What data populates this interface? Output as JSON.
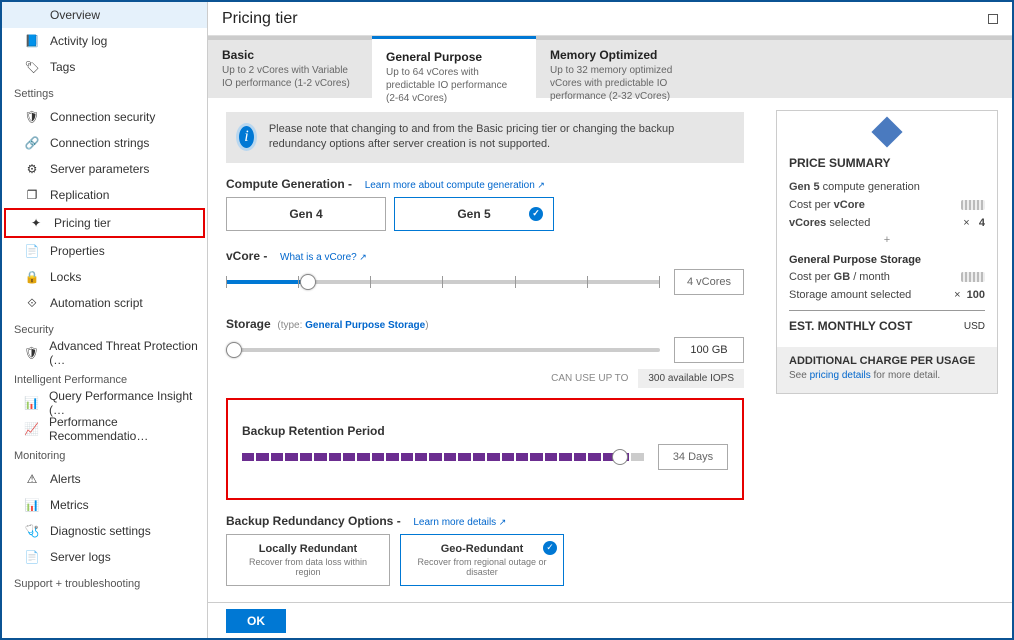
{
  "sidebar": {
    "items": [
      {
        "label": "Overview",
        "icon": ""
      },
      {
        "label": "Activity log",
        "icon": "📘"
      },
      {
        "label": "Tags",
        "icon": "🏷"
      }
    ],
    "settings_label": "Settings",
    "settings": [
      {
        "label": "Connection security",
        "icon": "🛡"
      },
      {
        "label": "Connection strings",
        "icon": "🔗"
      },
      {
        "label": "Server parameters",
        "icon": "⚙"
      },
      {
        "label": "Replication",
        "icon": "❐"
      },
      {
        "label": "Pricing tier",
        "icon": "✦"
      },
      {
        "label": "Properties",
        "icon": "📄"
      },
      {
        "label": "Locks",
        "icon": "🔒"
      },
      {
        "label": "Automation script",
        "icon": "⟐"
      }
    ],
    "security_label": "Security",
    "security": [
      {
        "label": "Advanced Threat Protection (…",
        "icon": "🛡"
      }
    ],
    "intel_label": "Intelligent Performance",
    "intel": [
      {
        "label": "Query Performance Insight (…",
        "icon": "📊"
      },
      {
        "label": "Performance Recommendatio…",
        "icon": "📈"
      }
    ],
    "mon_label": "Monitoring",
    "mon": [
      {
        "label": "Alerts",
        "icon": "⚠"
      },
      {
        "label": "Metrics",
        "icon": "📊"
      },
      {
        "label": "Diagnostic settings",
        "icon": "🩺"
      },
      {
        "label": "Server logs",
        "icon": "📄"
      }
    ],
    "support_label": "Support + troubleshooting"
  },
  "header": {
    "title": "Pricing tier"
  },
  "tiers": [
    {
      "title": "Basic",
      "sub": "Up to 2 vCores with\nVariable IO performance (1-2 vCores)"
    },
    {
      "title": "General Purpose",
      "sub": "Up to 64 vCores with\npredictable IO performance (2-64 vCores)"
    },
    {
      "title": "Memory Optimized",
      "sub": "Up to 32 memory optimized vCores with\npredictable IO performance (2-32 vCores)"
    }
  ],
  "info_note": "Please note that changing to and from the Basic pricing tier or changing the backup redundancy options after server creation is not supported.",
  "compute": {
    "label": "Compute Generation",
    "link": "Learn more about compute generation",
    "gen4": "Gen 4",
    "gen5": "Gen 5"
  },
  "vcore": {
    "label": "vCore",
    "link": "What is a vCore?",
    "value": "4 vCores"
  },
  "storage": {
    "label": "Storage",
    "type_prefix": "(type: ",
    "type": "General Purpose Storage",
    "type_suffix": ")",
    "value": "100 GB"
  },
  "iops": {
    "prefix": "CAN USE UP TO",
    "value": "300 available IOPS"
  },
  "retention": {
    "label": "Backup Retention Period",
    "value": "34 Days"
  },
  "redundancy": {
    "label": "Backup Redundancy Options",
    "link": "Learn more details",
    "local": {
      "title": "Locally Redundant",
      "sub": "Recover from data loss within region"
    },
    "geo": {
      "title": "Geo-Redundant",
      "sub": "Recover from regional outage or disaster"
    }
  },
  "ok": "OK",
  "price": {
    "title": "PRICE SUMMARY",
    "gen": "Gen 5",
    "gen_suffix": " compute generation",
    "cost_vcore": "Cost per vCore",
    "vcores_sel": "vCores selected",
    "vcores_val": "4",
    "mult": "×",
    "plus": "+",
    "storage_title": "General Purpose Storage",
    "cost_gb": "Cost per GB / month",
    "storage_sel": "Storage amount selected",
    "storage_val": "100",
    "est": "EST. MONTHLY COST",
    "usd": "USD",
    "extra_h": "ADDITIONAL CHARGE PER USAGE",
    "extra_s": "See ",
    "extra_link": "pricing details",
    "extra_s2": " for more detail."
  }
}
